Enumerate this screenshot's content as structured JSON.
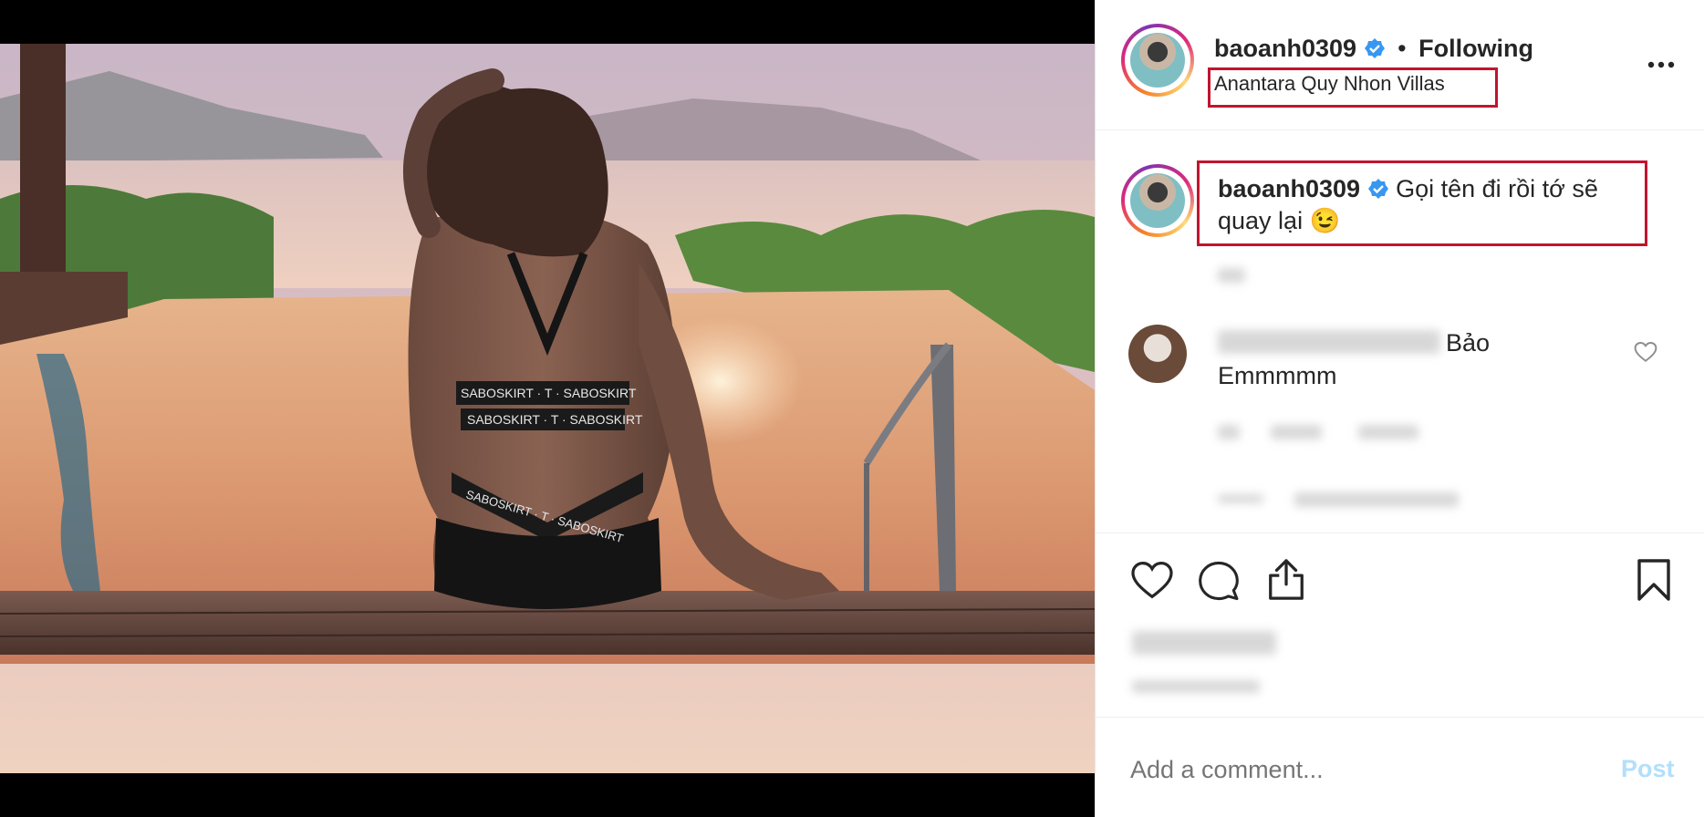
{
  "post": {
    "username": "baoanh0309",
    "dot": "•",
    "follow_status": "Following",
    "location": "Anantara Quy Nhon Villas",
    "caption_username": "baoanh0309",
    "caption_text": "Gọi tên đi rồi tớ sẽ quay lại 😉"
  },
  "comments": [
    {
      "text_line1": "Bảo",
      "text_line2": "Emmmmm"
    }
  ],
  "composer": {
    "placeholder": "Add a comment...",
    "post_label": "Post"
  },
  "photo": {
    "swimsuit_text": "SABOSKIRT · T · SABOSKIRT"
  },
  "colors": {
    "verified": "#3897f0",
    "highlight_box": "#c0152f",
    "post_button": "#b2dffc"
  },
  "icons": [
    "verified-badge-icon",
    "more-options-icon",
    "heart-icon",
    "comment-icon",
    "share-icon",
    "bookmark-icon",
    "comment-like-icon"
  ]
}
